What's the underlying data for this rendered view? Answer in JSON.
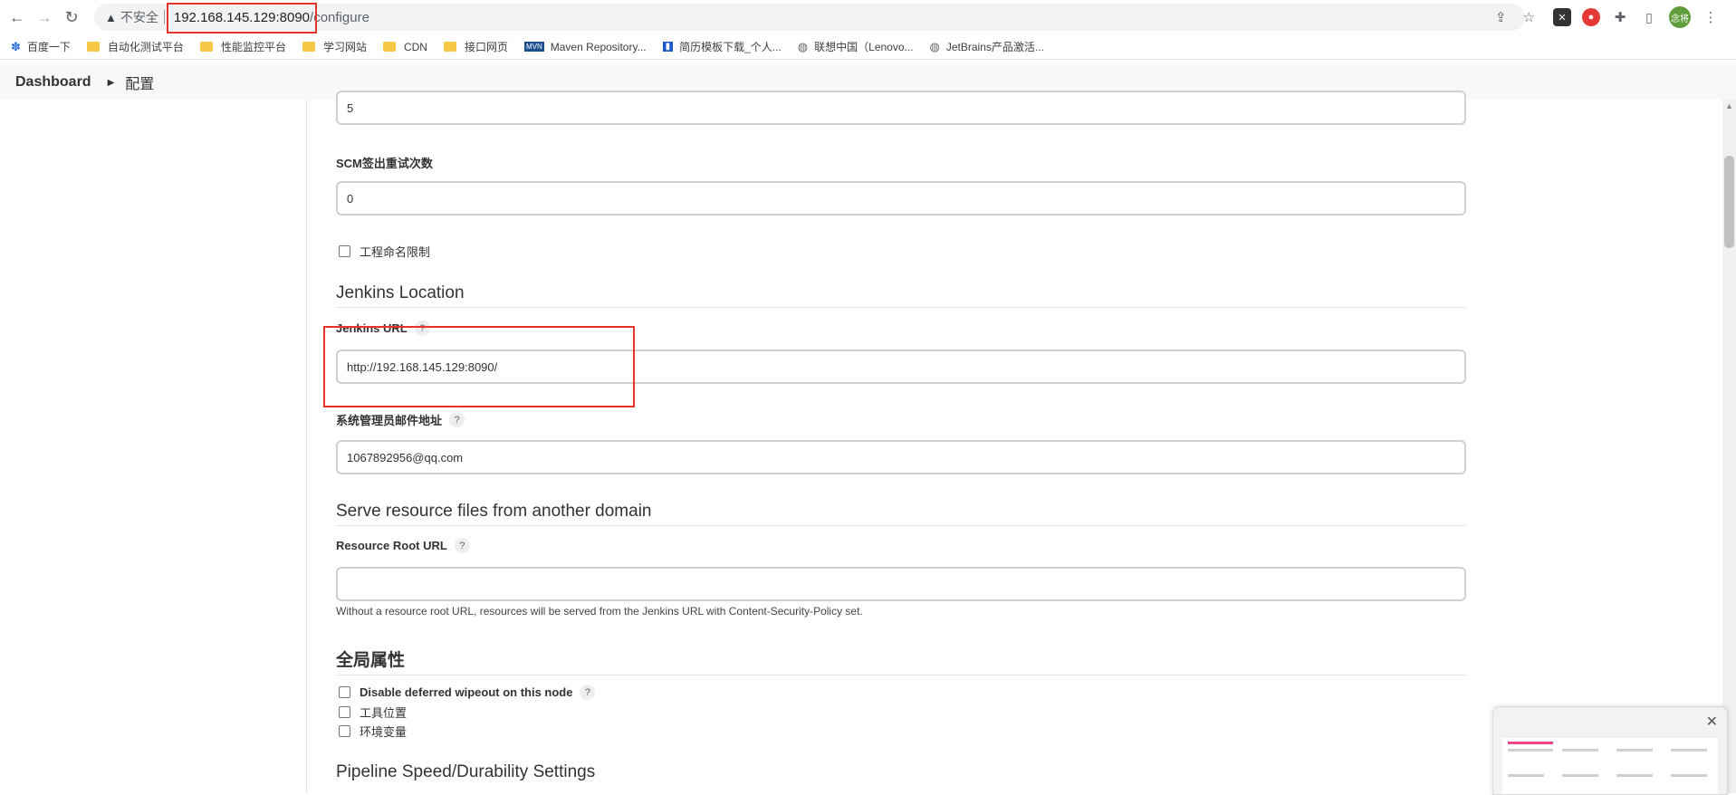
{
  "browser": {
    "insecure_label": "不安全",
    "url_host": "192.168.145.129:8090",
    "url_path": "/configure",
    "avatar_text": "念将"
  },
  "bookmarks": [
    {
      "label": "百度一下",
      "icon": "paw-icon"
    },
    {
      "label": "自动化测试平台",
      "icon": "folder-icon"
    },
    {
      "label": "性能监控平台",
      "icon": "folder-icon"
    },
    {
      "label": "学习网站",
      "icon": "folder-icon"
    },
    {
      "label": "CDN",
      "icon": "folder-icon"
    },
    {
      "label": "接口网页",
      "icon": "folder-icon"
    },
    {
      "label": "Maven Repository...",
      "icon": "mvn-icon"
    },
    {
      "label": "简历模板下载_个人...",
      "icon": "doc-icon"
    },
    {
      "label": "联想中国（Lenovo...",
      "icon": "globe-icon"
    },
    {
      "label": "JetBrains产品激活...",
      "icon": "globe-icon"
    }
  ],
  "breadcrumb": {
    "item1": "Dashboard",
    "item2": "配置"
  },
  "form": {
    "top_value": "5",
    "scm_label": "SCM签出重试次数",
    "scm_value": "0",
    "project_naming_label": "工程命名限制",
    "jenkins_location_title": "Jenkins Location",
    "jenkins_url_label": "Jenkins URL",
    "jenkins_url_value": "http://192.168.145.129:8090/",
    "admin_email_label": "系统管理员邮件地址",
    "admin_email_value": "1067892956@qq.com",
    "serve_resource_title": "Serve resource files from another domain",
    "resource_root_label": "Resource Root URL",
    "resource_root_value": "",
    "resource_root_help": "Without a resource root URL, resources will be served from the Jenkins URL with Content-Security-Policy set.",
    "global_props_title": "全局属性",
    "disable_wipeout_label": "Disable deferred wipeout on this node",
    "tool_locations_label": "工具位置",
    "env_vars_label": "环境变量",
    "pipeline_title": "Pipeline Speed/Durability Settings",
    "help_glyph": "?"
  }
}
